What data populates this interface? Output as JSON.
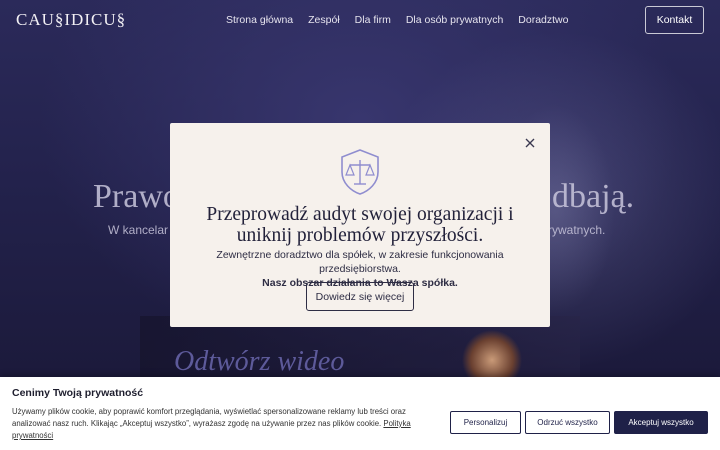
{
  "header": {
    "logo": "CAU§IDICU§",
    "nav": [
      "Strona główna",
      "Zespół",
      "Dla firm",
      "Dla osób prywatnych",
      "Doradztwo"
    ],
    "contact_label": "Kontakt"
  },
  "hero": {
    "title_left": "Prawo",
    "title_right": "dbają.",
    "subtitle_left": "W kancelar",
    "subtitle_right": "rywatnych."
  },
  "video": {
    "label": "Odtwórz wideo"
  },
  "modal": {
    "icon": "shield-scales-icon",
    "title": "Przeprowadź audyt swojej organizacji i uniknij problemów przyszłości.",
    "description": "Zewnętrzne doradztwo dla spółek, w zakresie funkcjonowania przedsiębiorstwa.",
    "description_bold": "Nasz obszar działania to Wasza spółka.",
    "button_label": "Dowiedz się więcej",
    "accent_color": "#8f8dcf"
  },
  "cookie": {
    "title": "Cenimy Twoją prywatność",
    "text": "Używamy plików cookie, aby poprawić komfort przeglądania, wyświetlać spersonalizowane reklamy lub treści oraz analizować nasz ruch. Klikając „Akceptuj wszystko”, wyrażasz zgodę na używanie przez nas plików cookie.",
    "link": "Polityka prywatności",
    "btn_personalize": "Personalizuj",
    "btn_reject": "Odrzuć wszystko",
    "btn_accept": "Akceptuj wszystko",
    "accent_color": "#1f2148"
  }
}
